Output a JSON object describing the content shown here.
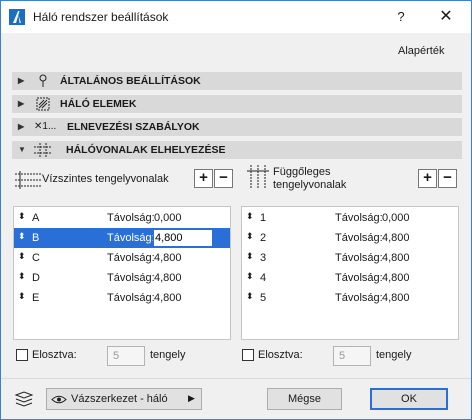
{
  "window": {
    "title": "Háló rendszer beállítások",
    "help": "?",
    "close": "✕"
  },
  "defaults_label": "Alapérték",
  "sections": [
    {
      "label": "ÁLTALÁNOS BEÁLLÍTÁSOK",
      "icon": "pin-icon",
      "expanded": false
    },
    {
      "label": "HÁLÓ ELEMEK",
      "icon": "hatch-box-icon",
      "expanded": false
    },
    {
      "label": "ELNEVEZÉSI SZABÁLYOK",
      "icon": "numbering-icon",
      "icon_text": "✕1...",
      "expanded": false
    },
    {
      "label": "HÁLÓVONALAK ELHELYEZÉSE",
      "icon": "grid-lines-icon",
      "expanded": true
    }
  ],
  "horizontal": {
    "title": "Vízszintes tengelyvonalak",
    "add": "+",
    "remove": "−",
    "rows": [
      {
        "name": "A",
        "label": "Távolság:",
        "value": "0,000",
        "selected": false
      },
      {
        "name": "B",
        "label": "Távolság:",
        "value": "4,800",
        "selected": true
      },
      {
        "name": "C",
        "label": "Távolság:",
        "value": "4,800",
        "selected": false
      },
      {
        "name": "D",
        "label": "Távolság:",
        "value": "4,800",
        "selected": false
      },
      {
        "name": "E",
        "label": "Távolság:",
        "value": "4,800",
        "selected": false
      }
    ],
    "distribute_label": "Elosztva:",
    "distribute_value": "5",
    "distribute_unit": "tengely"
  },
  "vertical": {
    "title_line1": "Függőleges",
    "title_line2": "tengelyvonalak",
    "add": "+",
    "remove": "−",
    "rows": [
      {
        "name": "1",
        "label": "Távolság:",
        "value": "0,000"
      },
      {
        "name": "2",
        "label": "Távolság:",
        "value": "4,800"
      },
      {
        "name": "3",
        "label": "Távolság:",
        "value": "4,800"
      },
      {
        "name": "4",
        "label": "Távolság:",
        "value": "4,800"
      },
      {
        "name": "5",
        "label": "Távolság:",
        "value": "4,800"
      }
    ],
    "distribute_label": "Elosztva:",
    "distribute_value": "5",
    "distribute_unit": "tengely"
  },
  "footer": {
    "view_label": "Vázszerkezet - háló",
    "cancel": "Mégse",
    "ok": "OK"
  },
  "colors": {
    "accent": "#2a6fd8",
    "section_bg": "#d9d9d9"
  }
}
